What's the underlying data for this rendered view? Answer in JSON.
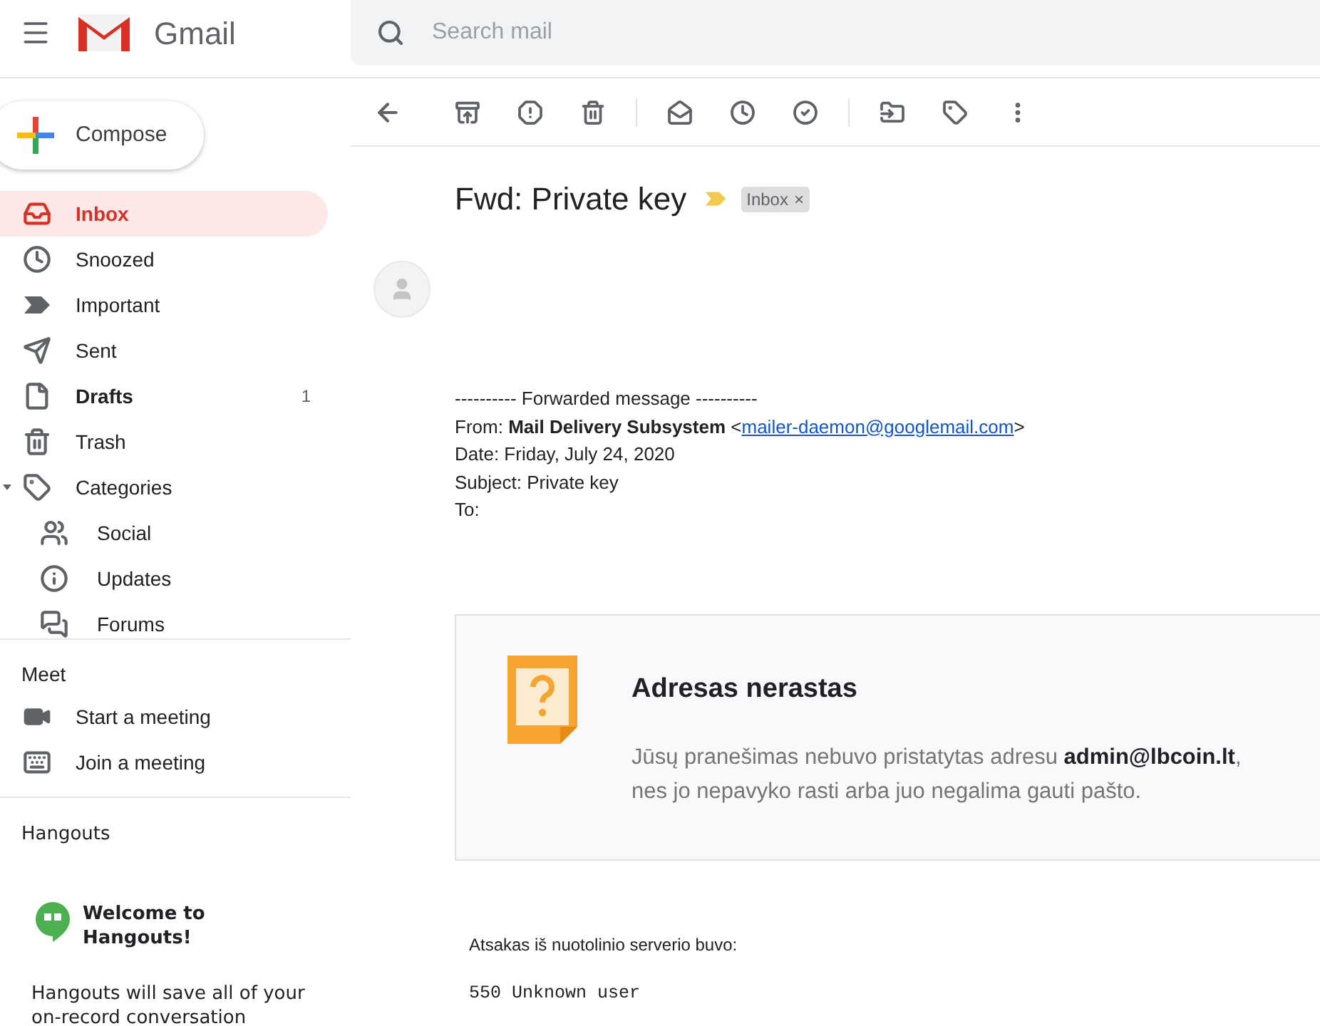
{
  "header": {
    "app_name": "Gmail",
    "search_placeholder": "Search mail"
  },
  "compose": {
    "label": "Compose"
  },
  "nav": [
    {
      "label": "Inbox",
      "selected": true,
      "unread": true
    },
    {
      "label": "Snoozed",
      "selected": false,
      "unread": false
    },
    {
      "label": "Important",
      "selected": false,
      "unread": false
    },
    {
      "label": "Sent",
      "selected": false,
      "unread": false
    },
    {
      "label": "Drafts",
      "selected": false,
      "unread": true,
      "count": "1"
    },
    {
      "label": "Trash",
      "selected": false,
      "unread": false
    },
    {
      "label": "Categories",
      "selected": false,
      "unread": false,
      "expanded": true,
      "children": [
        {
          "label": "Social",
          "selected": false,
          "unread": false
        },
        {
          "label": "Updates",
          "selected": false,
          "unread": false
        },
        {
          "label": "Forums",
          "selected": false,
          "unread": false
        }
      ]
    }
  ],
  "meet": {
    "title": "Meet",
    "items": [
      "Start a meeting",
      "Join a meeting"
    ]
  },
  "hangouts": {
    "title": "Hangouts",
    "welcome": "Welcome to Hangouts!",
    "text": "Hangouts will save all of your on-record conversation"
  },
  "email": {
    "subject": "Fwd: Private key",
    "labels": [
      {
        "kind": "important"
      },
      {
        "kind": "chip",
        "text": "Inbox",
        "remove": "×"
      }
    ],
    "forwarded": {
      "separator": "---------- Forwarded message ----------",
      "from": {
        "prefix": "From: **Mail Delivery Subsystem** <",
        "link": "mailer-daemon@googlemail.com",
        "suffix": ">"
      },
      "lines": [
        "Date: Friday, July 24, 2020",
        "Subject: Private key",
        "To:"
      ]
    },
    "notice": {
      "title": "Adresas nerastas",
      "message": "Jūsų pranešimas nebuvo pristatytas adresu **admin@lbcoin.lt**, nes jo nepavyko rasti arba juo negalima gauti pašto."
    },
    "response_label": "Atsakas iš nuotolinio serverio buvo:",
    "response_code": "550 Unknown user"
  }
}
